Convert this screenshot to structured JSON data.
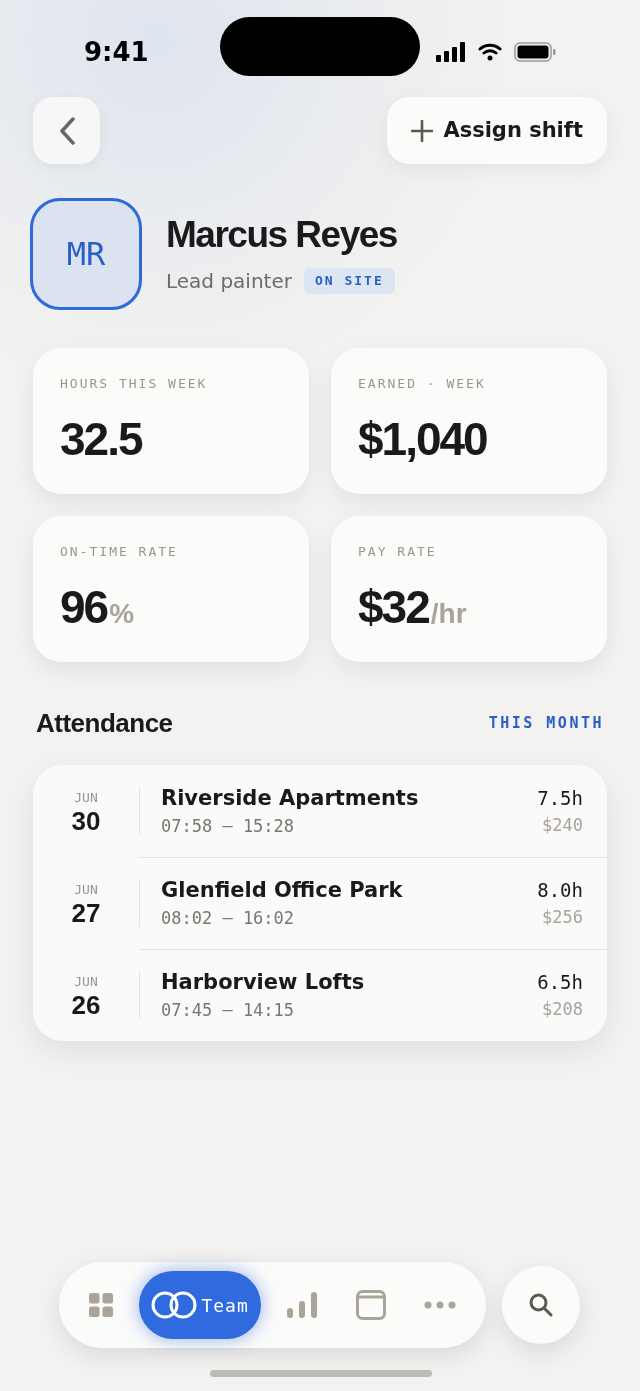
{
  "status_bar": {
    "time": "9:41"
  },
  "header": {
    "action": {
      "label": "Assign shift"
    }
  },
  "profile": {
    "initials": "MR",
    "name": "Marcus Reyes",
    "role": "Lead painter",
    "badge": "ON SITE"
  },
  "stats": [
    {
      "label": "HOURS THIS WEEK",
      "value": "32.5"
    },
    {
      "label": "EARNED · WEEK",
      "value": "$1,040"
    },
    {
      "label": "ON-TIME RATE",
      "value": "96",
      "unit": "%"
    },
    {
      "label": "PAY RATE",
      "value": "$32",
      "unit": "/hr"
    }
  ],
  "attendance": {
    "title": "Attendance",
    "filter": "THIS MONTH",
    "rows": [
      {
        "month": "JUN",
        "day": "30",
        "site": "Riverside Apartments",
        "time": "07:58 – 15:28",
        "hours": "7.5h",
        "pay": "$240"
      },
      {
        "month": "JUN",
        "day": "27",
        "site": "Glenfield Office Park",
        "time": "08:02 – 16:02",
        "hours": "8.0h",
        "pay": "$256"
      },
      {
        "month": "JUN",
        "day": "26",
        "site": "Harborview Lofts",
        "time": "07:45 – 14:15",
        "hours": "6.5h",
        "pay": "$208"
      }
    ]
  },
  "tab_bar": {
    "tabs": [
      {
        "kind": "grid",
        "selected": false
      },
      {
        "kind": "team",
        "label": "Team",
        "selected": true
      },
      {
        "kind": "chart",
        "selected": false
      },
      {
        "kind": "calendar",
        "selected": false
      },
      {
        "kind": "more",
        "selected": false
      }
    ]
  }
}
